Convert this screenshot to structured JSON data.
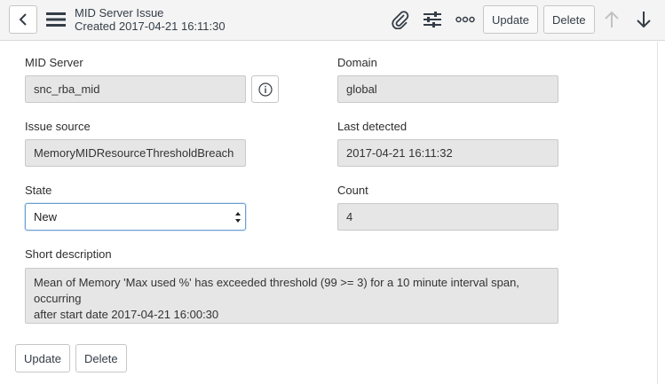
{
  "header": {
    "title": "MID Server Issue",
    "subtitle": "Created 2017-04-21 16:11:30",
    "update_label": "Update",
    "delete_label": "Delete"
  },
  "form": {
    "mid_server": {
      "label": "MID Server",
      "value": "snc_rba_mid"
    },
    "domain": {
      "label": "Domain",
      "value": "global"
    },
    "issue_source": {
      "label": "Issue source",
      "value": "MemoryMIDResourceThresholdBreach"
    },
    "last_detected": {
      "label": "Last detected",
      "value": "2017-04-21 16:11:32"
    },
    "state": {
      "label": "State",
      "value": "New"
    },
    "count": {
      "label": "Count",
      "value": "4"
    },
    "short_description": {
      "label": "Short description",
      "line1": "Mean of Memory 'Max used %' has exceeded threshold (99 >= 3) for a 10 minute interval span, occurring",
      "line2": "after start date 2017-04-21 16:00:30"
    }
  },
  "footer": {
    "update_label": "Update",
    "delete_label": "Delete"
  },
  "icons": [
    "back-icon",
    "menu-icon",
    "attachment-icon",
    "settings-icon",
    "more-icon",
    "arrow-up-icon",
    "arrow-down-icon",
    "info-icon"
  ]
}
